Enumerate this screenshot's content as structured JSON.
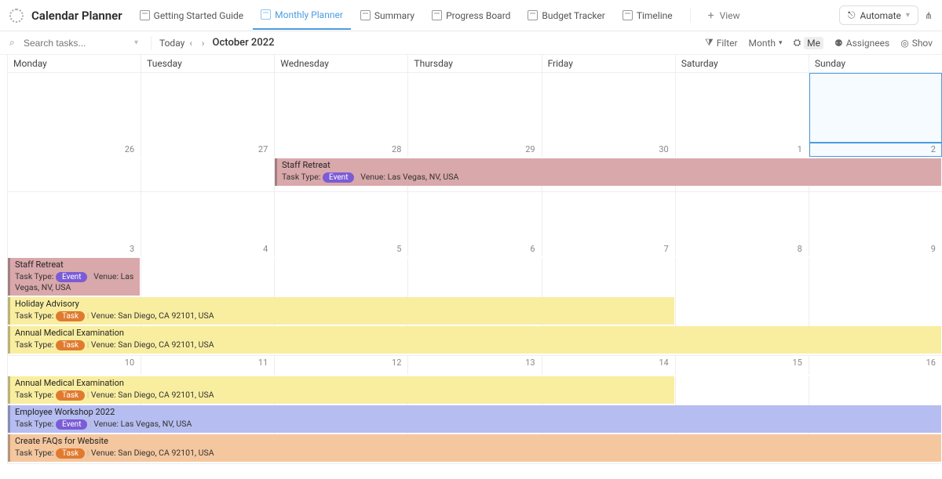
{
  "header": {
    "title": "Calendar Planner",
    "tabs": [
      {
        "label": "Getting Started Guide"
      },
      {
        "label": "Monthly Planner",
        "active": true
      },
      {
        "label": "Summary"
      },
      {
        "label": "Progress Board"
      },
      {
        "label": "Budget Tracker"
      },
      {
        "label": "Timeline"
      }
    ],
    "add_view": "View",
    "automate": "Automate"
  },
  "toolbar": {
    "search_placeholder": "Search tasks...",
    "today": "Today",
    "month_label": "October 2022",
    "filter": "Filter",
    "period": "Month",
    "me": "Me",
    "assignees": "Assignees",
    "show": "Shov"
  },
  "day_headers": [
    "Monday",
    "Tuesday",
    "Wednesday",
    "Thursday",
    "Friday",
    "Saturday",
    "Sunday"
  ],
  "weeks": [
    {
      "nums": [
        "26",
        "27",
        "28",
        "29",
        "30",
        "1",
        "2"
      ],
      "today_index": 6
    },
    {
      "nums": [
        "3",
        "4",
        "5",
        "6",
        "7",
        "8",
        "9"
      ]
    },
    {
      "nums": [
        "10",
        "11",
        "12",
        "13",
        "14",
        "15",
        "16"
      ]
    }
  ],
  "events": {
    "w0": [
      {
        "title": "Staff Retreat",
        "type_label": "Task Type:",
        "type": "Event",
        "venue_label": "Venue:",
        "venue": "Las Vegas, NV, USA",
        "width": "w-5",
        "offset": "offset-2",
        "bg": "bg-rose"
      }
    ],
    "w1": [
      {
        "title": "Staff Retreat",
        "type_label": "Task Type:",
        "type": "Event",
        "venue_label": "Venue:",
        "venue": "Las Vegas, NV, USA",
        "width": "w-1",
        "bg": "bg-rose"
      },
      {
        "title": "Holiday Advisory",
        "type_label": "Task Type:",
        "type": "Task",
        "venue_label": "Venue:",
        "venue": "San Diego, CA 92101, USA",
        "width": "w-5",
        "bg": "bg-yellow"
      },
      {
        "title": "Annual Medical Examination",
        "type_label": "Task Type:",
        "type": "Task",
        "venue_label": "Venue:",
        "venue": "San Diego, CA 92101, USA",
        "width": "w-7",
        "bg": "bg-yellow"
      }
    ],
    "w2": [
      {
        "title": "Annual Medical Examination",
        "type_label": "Task Type:",
        "type": "Task",
        "venue_label": "Venue:",
        "venue": "San Diego, CA 92101, USA",
        "width": "w-5",
        "bg": "bg-yellow"
      },
      {
        "title": "Employee Workshop 2022",
        "type_label": "Task Type:",
        "type": "Event",
        "venue_label": "Venue:",
        "venue": "Las Vegas, NV, USA",
        "width": "w-7",
        "bg": "bg-blue"
      },
      {
        "title": "Create FAQs for Website",
        "type_label": "Task Type:",
        "type": "Task",
        "venue_label": "Venue:",
        "venue": "San Diego, CA 92101, USA",
        "width": "w-7",
        "bg": "bg-orange"
      }
    ]
  }
}
